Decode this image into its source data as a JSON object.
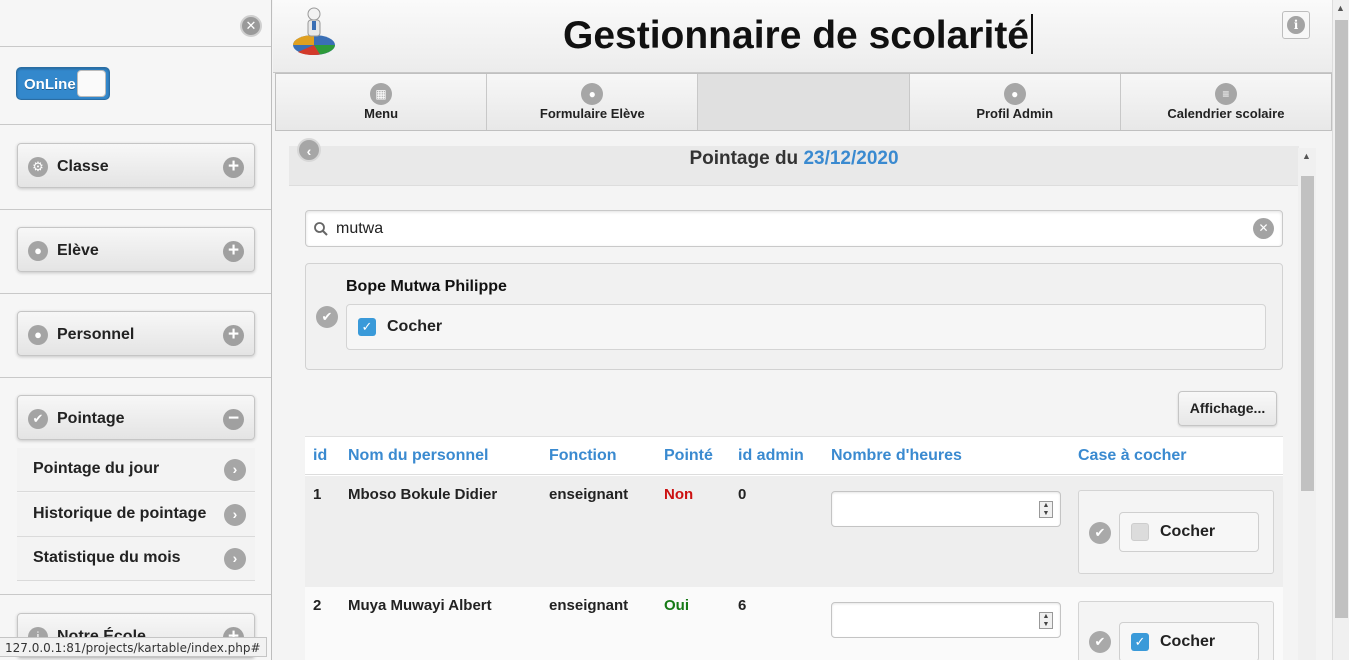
{
  "sidebar": {
    "online_label": "OnLine",
    "menus": [
      {
        "label": "Classe",
        "icon": "gear-icon",
        "state": "+"
      },
      {
        "label": "Elève",
        "icon": "user-icon",
        "state": "+"
      },
      {
        "label": "Personnel",
        "icon": "user-icon",
        "state": "+"
      },
      {
        "label": "Pointage",
        "icon": "check-icon",
        "state": "−"
      },
      {
        "label": "Notre École",
        "icon": "info-icon",
        "state": "+"
      }
    ],
    "pointage_items": [
      "Pointage du jour",
      "Historique de pointage",
      "Statistique du mois"
    ]
  },
  "status_url": "127.0.0.1:81/projects/kartable/index.php#",
  "header": {
    "title": "Gestionnaire de scolarité"
  },
  "nav": [
    {
      "label": "Menu",
      "icon": "grid-icon"
    },
    {
      "label": "Formulaire Elève",
      "icon": "user-icon"
    },
    {
      "label": "",
      "icon": ""
    },
    {
      "label": "Profil Admin",
      "icon": "user-icon"
    },
    {
      "label": "Calendrier scolaire",
      "icon": "bars-icon"
    }
  ],
  "page": {
    "title_prefix": "Pointage du",
    "date": "23/12/2020",
    "search_value": "mutwa",
    "result": {
      "name": "Bope Mutwa Philippe",
      "checkbox_label": "Cocher",
      "checked": true
    },
    "display_button": "Affichage..."
  },
  "table": {
    "headers": [
      "id",
      "Nom du personnel",
      "Fonction",
      "Pointé",
      "id admin",
      "Nombre d'heures",
      "Case à cocher"
    ],
    "rows": [
      {
        "id": "1",
        "name": "Mboso Bokule Didier",
        "fonction": "enseignant",
        "pointe": "Non",
        "id_admin": "0",
        "heures": "",
        "checkbox_label": "Cocher",
        "checked": false
      },
      {
        "id": "2",
        "name": "Muya Muwayi Albert",
        "fonction": "enseignant",
        "pointe": "Oui",
        "id_admin": "6",
        "heures": "",
        "checkbox_label": "Cocher",
        "checked": true
      }
    ]
  },
  "colors": {
    "accent": "#3a8ad0",
    "toggle": "#3388cc",
    "no": "#cc1111",
    "yes": "#167a16",
    "checkbox": "#3a9ad9"
  }
}
